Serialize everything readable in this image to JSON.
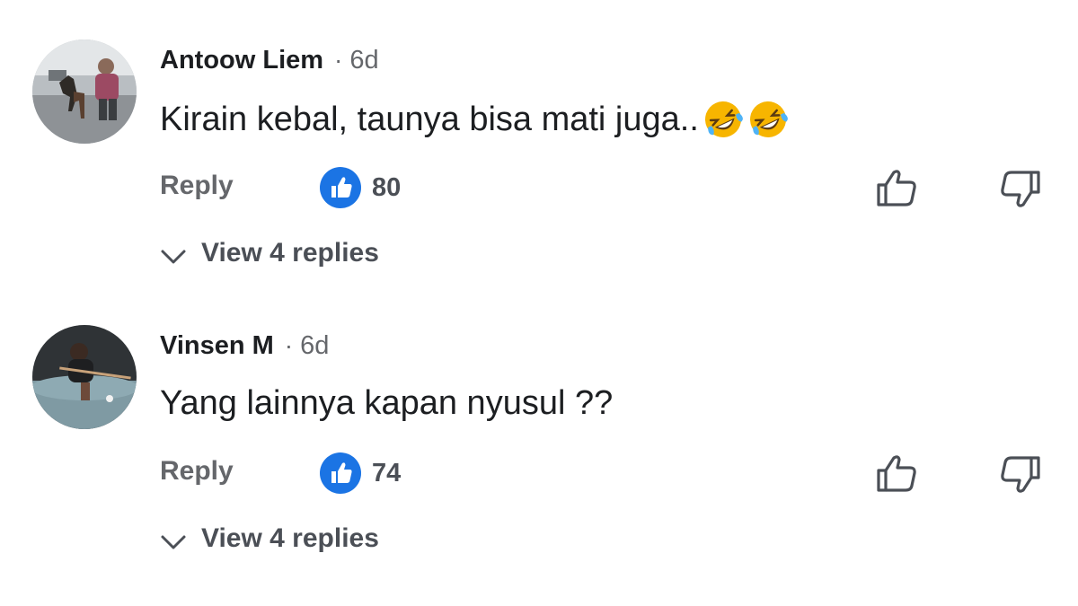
{
  "comments": [
    {
      "author": "Antoow Liem",
      "separator": "·",
      "time": "6d",
      "text": "Kirain kebal, taunya bisa mati juga..",
      "emojis": [
        "rolling-on-floor-laughing",
        "rolling-on-floor-laughing"
      ],
      "reply_label": "Reply",
      "like_count": "80",
      "view_replies_label": "View 4 replies"
    },
    {
      "author": "Vinsen M",
      "separator": "·",
      "time": "6d",
      "text": "Yang lainnya kapan nyusul ??",
      "emojis": [],
      "reply_label": "Reply",
      "like_count": "74",
      "view_replies_label": "View 4 replies"
    }
  ],
  "colors": {
    "like_badge": "#1b74e4",
    "secondary_text": "#65676b",
    "primary_text": "#1c1e21"
  }
}
